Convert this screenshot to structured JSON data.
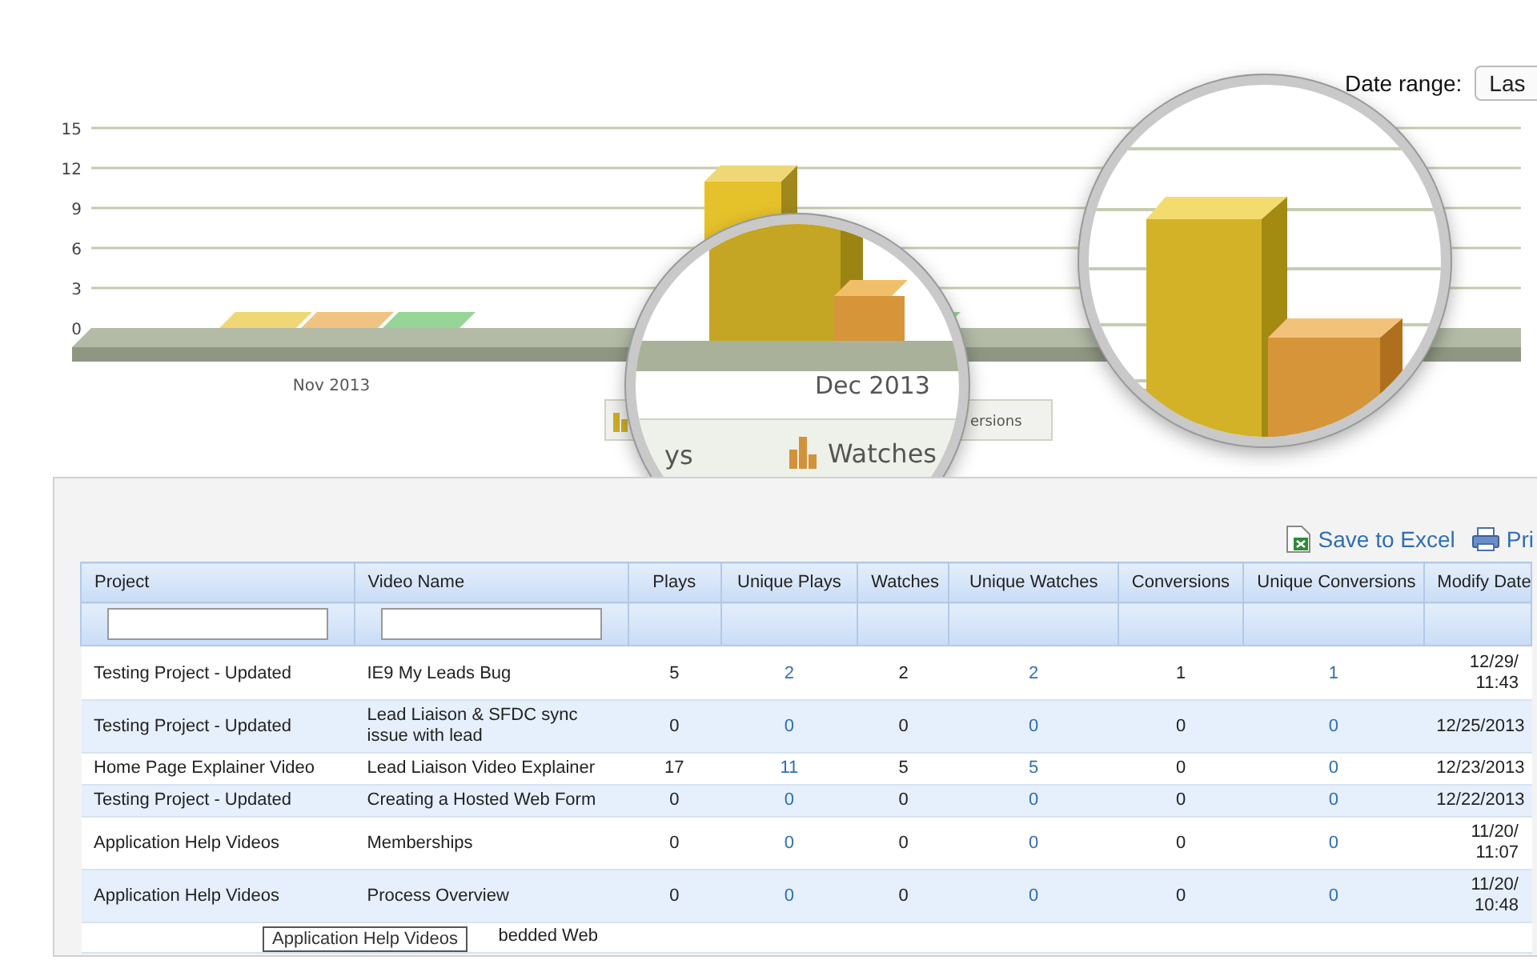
{
  "date_range": {
    "label": "Date range:",
    "value": "Las"
  },
  "chart": {
    "y_axis_labels": [
      "15",
      "12",
      "9",
      "6",
      "3",
      "0"
    ],
    "x_axis_labels": [
      "Nov 2013",
      "Dec 2013"
    ],
    "legend": [
      {
        "label": "ys"
      },
      {
        "label": "Watches"
      },
      {
        "label": "ersions"
      }
    ]
  },
  "toolbar": [
    {
      "kind": "excel",
      "label": "Save to Excel"
    },
    {
      "kind": "printer",
      "label": "Pri"
    }
  ],
  "table": {
    "columns": [
      {
        "label": "Project",
        "filter": true,
        "link": false
      },
      {
        "label": "Video Name",
        "filter": true,
        "link": false
      },
      {
        "label": "Plays",
        "filter": false,
        "link": false
      },
      {
        "label": "Unique Plays",
        "filter": false,
        "link": true
      },
      {
        "label": "Watches",
        "filter": false,
        "link": false
      },
      {
        "label": "Unique Watches",
        "filter": false,
        "link": true
      },
      {
        "label": "Conversions",
        "filter": false,
        "link": false
      },
      {
        "label": "Unique Conversions",
        "filter": false,
        "link": true
      },
      {
        "label": "Modify Date",
        "filter": false,
        "link": false
      }
    ],
    "rows": [
      {
        "cells": [
          "Testing Project - Updated",
          "IE9 My Leads Bug",
          "5",
          "2",
          "2",
          "2",
          "1",
          "1",
          "12/29/\n11:43"
        ]
      },
      {
        "cells": [
          "Testing Project - Updated",
          "Lead Liaison & SFDC sync issue with lead",
          "0",
          "0",
          "0",
          "0",
          "0",
          "0",
          "12/25/2013"
        ]
      },
      {
        "cells": [
          "Home Page Explainer Video",
          "Lead Liaison Video Explainer",
          "17",
          "11",
          "5",
          "5",
          "0",
          "0",
          "12/23/2013"
        ]
      },
      {
        "cells": [
          "Testing Project - Updated",
          "Creating a Hosted Web Form",
          "0",
          "0",
          "0",
          "0",
          "0",
          "0",
          "12/22/2013"
        ]
      },
      {
        "cells": [
          "Application Help Videos",
          "Memberships",
          "0",
          "0",
          "0",
          "0",
          "0",
          "0",
          "11/20/\n11:07"
        ]
      },
      {
        "cells": [
          "Application Help Videos",
          "Process Overview",
          "0",
          "0",
          "0",
          "0",
          "0",
          "0",
          "11/20/\n10:48"
        ]
      }
    ],
    "partial_row": {
      "video_name": "bedded Web"
    },
    "tooltip": "Application Help Videos"
  }
}
